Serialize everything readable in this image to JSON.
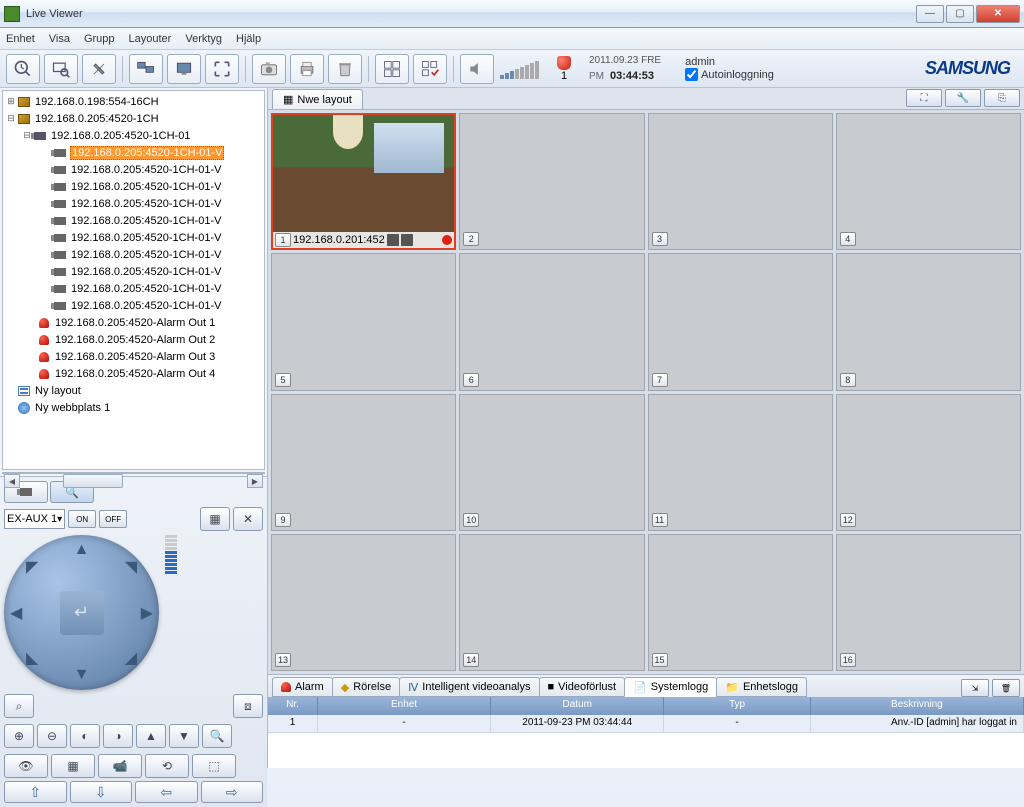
{
  "window": {
    "title": "Live Viewer"
  },
  "menu": [
    "Enhet",
    "Visa",
    "Grupp",
    "Layouter",
    "Verktyg",
    "Hjälp"
  ],
  "toolbar": {
    "alarm_count": "1",
    "date": "2011.09.23 FRE",
    "ampm": "PM",
    "time": "03:44:53",
    "user": "admin",
    "autologin": "Autoinloggning",
    "brand": "SAMSUNG"
  },
  "tree": {
    "n1": "192.168.0.198:554-16CH",
    "n2": "192.168.0.205:4520-1CH",
    "n3": "192.168.0.205:4520-1CH-01",
    "sel": "192.168.0.205:4520-1CH-01-V",
    "ch": "192.168.0.205:4520-1CH-01-V",
    "a1": "192.168.0.205:4520-Alarm Out 1",
    "a2": "192.168.0.205:4520-Alarm Out 2",
    "a3": "192.168.0.205:4520-Alarm Out 3",
    "a4": "192.168.0.205:4520-Alarm Out 4",
    "layout": "Ny layout",
    "site": "Ny webbplats 1"
  },
  "ptz": {
    "aux": "EX-AUX 1",
    "on": "ON",
    "off": "OFF"
  },
  "layout_tab": "Nwe layout",
  "live_cell": {
    "num": "1",
    "addr": "192.168.0.201:452"
  },
  "cells": [
    "2",
    "3",
    "4",
    "5",
    "6",
    "7",
    "8",
    "9",
    "10",
    "11",
    "12",
    "13",
    "14",
    "15",
    "16"
  ],
  "log": {
    "tabs": {
      "alarm": "Alarm",
      "motion": "Rörelse",
      "iva": "Intelligent videoanalys",
      "loss": "Videoförlust",
      "sys": "Systemlogg",
      "dev": "Enhetslogg"
    },
    "cols": {
      "nr": "Nr.",
      "enhet": "Enhet",
      "datum": "Datum",
      "typ": "Typ",
      "besk": "Beskrivning"
    },
    "row": {
      "nr": "1",
      "enhet": "-",
      "datum": "2011-09-23 PM 03:44:44",
      "typ": "-",
      "besk": "Anv.-ID [admin] har loggat in"
    }
  }
}
